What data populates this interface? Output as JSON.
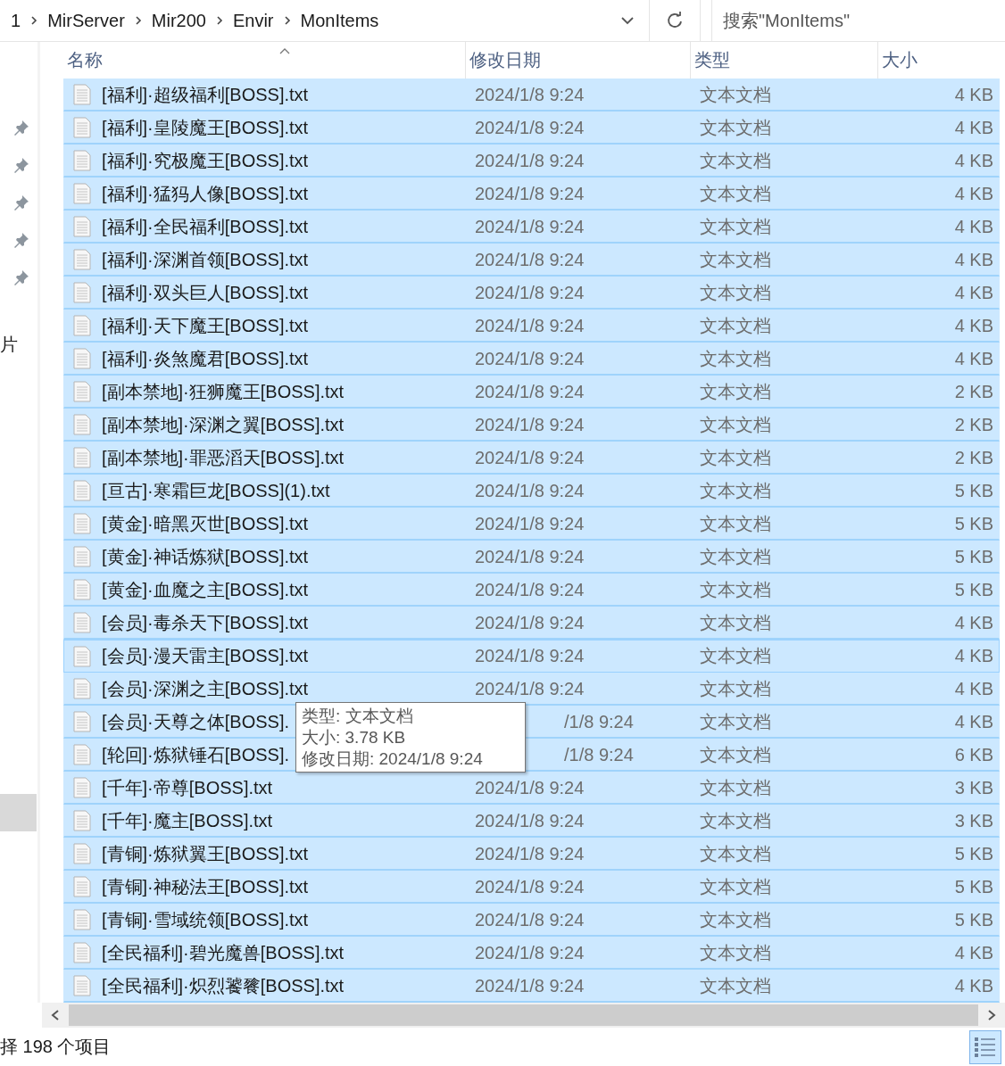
{
  "address_bar": {
    "path": [
      "1",
      "MirServer",
      "Mir200",
      "Envir",
      "MonItems"
    ]
  },
  "search": {
    "placeholder": "搜索\"MonItems\""
  },
  "sidebar": {
    "items": [
      {
        "kind": "text",
        "label": "片",
        "selected": false
      },
      {
        "kind": "blank",
        "selected": true
      }
    ]
  },
  "table": {
    "columns": [
      "名称",
      "修改日期",
      "类型",
      "大小"
    ],
    "rows": [
      {
        "name": "[福利]·超级福利[BOSS].txt",
        "date": "2024/1/8 9:24",
        "type": "文本文档",
        "size": "4 KB",
        "selected": true,
        "focused": false
      },
      {
        "name": "[福利]·皇陵魔王[BOSS].txt",
        "date": "2024/1/8 9:24",
        "type": "文本文档",
        "size": "4 KB",
        "selected": true,
        "focused": false
      },
      {
        "name": "[福利]·究极魔王[BOSS].txt",
        "date": "2024/1/8 9:24",
        "type": "文本文档",
        "size": "4 KB",
        "selected": true,
        "focused": false
      },
      {
        "name": "[福利]·猛犸人像[BOSS].txt",
        "date": "2024/1/8 9:24",
        "type": "文本文档",
        "size": "4 KB",
        "selected": true,
        "focused": false
      },
      {
        "name": "[福利]·全民福利[BOSS].txt",
        "date": "2024/1/8 9:24",
        "type": "文本文档",
        "size": "4 KB",
        "selected": true,
        "focused": false
      },
      {
        "name": "[福利]·深渊首领[BOSS].txt",
        "date": "2024/1/8 9:24",
        "type": "文本文档",
        "size": "4 KB",
        "selected": true,
        "focused": false
      },
      {
        "name": "[福利]·双头巨人[BOSS].txt",
        "date": "2024/1/8 9:24",
        "type": "文本文档",
        "size": "4 KB",
        "selected": true,
        "focused": false
      },
      {
        "name": "[福利]·天下魔王[BOSS].txt",
        "date": "2024/1/8 9:24",
        "type": "文本文档",
        "size": "4 KB",
        "selected": true,
        "focused": false
      },
      {
        "name": "[福利]·炎煞魔君[BOSS].txt",
        "date": "2024/1/8 9:24",
        "type": "文本文档",
        "size": "4 KB",
        "selected": true,
        "focused": false
      },
      {
        "name": "[副本禁地]·狂狮魔王[BOSS].txt",
        "date": "2024/1/8 9:24",
        "type": "文本文档",
        "size": "2 KB",
        "selected": true,
        "focused": false
      },
      {
        "name": "[副本禁地]·深渊之翼[BOSS].txt",
        "date": "2024/1/8 9:24",
        "type": "文本文档",
        "size": "2 KB",
        "selected": true,
        "focused": false
      },
      {
        "name": "[副本禁地]·罪恶滔天[BOSS].txt",
        "date": "2024/1/8 9:24",
        "type": "文本文档",
        "size": "2 KB",
        "selected": true,
        "focused": false
      },
      {
        "name": "[亘古]·寒霜巨龙[BOSS](1).txt",
        "date": "2024/1/8 9:24",
        "type": "文本文档",
        "size": "5 KB",
        "selected": true,
        "focused": false
      },
      {
        "name": "[黄金]·暗黑灭世[BOSS].txt",
        "date": "2024/1/8 9:24",
        "type": "文本文档",
        "size": "5 KB",
        "selected": true,
        "focused": false
      },
      {
        "name": "[黄金]·神话炼狱[BOSS].txt",
        "date": "2024/1/8 9:24",
        "type": "文本文档",
        "size": "5 KB",
        "selected": true,
        "focused": false
      },
      {
        "name": "[黄金]·血魔之主[BOSS].txt",
        "date": "2024/1/8 9:24",
        "type": "文本文档",
        "size": "5 KB",
        "selected": true,
        "focused": false
      },
      {
        "name": "[会员]·毒杀天下[BOSS].txt",
        "date": "2024/1/8 9:24",
        "type": "文本文档",
        "size": "4 KB",
        "selected": true,
        "focused": false
      },
      {
        "name": "[会员]·漫天雷主[BOSS].txt",
        "date": "2024/1/8 9:24",
        "type": "文本文档",
        "size": "4 KB",
        "selected": true,
        "focused": true
      },
      {
        "name": "[会员]·深渊之主[BOSS].txt",
        "date": "2024/1/8 9:24",
        "type": "文本文档",
        "size": "4 KB",
        "selected": true,
        "focused": false
      },
      {
        "name": "[会员]·天尊之体[BOSS].",
        "date": "/1/8 9:24",
        "type": "文本文档",
        "size": "4 KB",
        "selected": true,
        "focused": false
      },
      {
        "name": "[轮回]·炼狱锤石[BOSS].",
        "date": "/1/8 9:24",
        "type": "文本文档",
        "size": "6 KB",
        "selected": true,
        "focused": false
      },
      {
        "name": "[千年]·帝尊[BOSS].txt",
        "date": "2024/1/8 9:24",
        "type": "文本文档",
        "size": "3 KB",
        "selected": true,
        "focused": false
      },
      {
        "name": "[千年]·魔主[BOSS].txt",
        "date": "2024/1/8 9:24",
        "type": "文本文档",
        "size": "3 KB",
        "selected": true,
        "focused": false
      },
      {
        "name": "[青铜]·炼狱翼王[BOSS].txt",
        "date": "2024/1/8 9:24",
        "type": "文本文档",
        "size": "5 KB",
        "selected": true,
        "focused": false
      },
      {
        "name": "[青铜]·神秘法王[BOSS].txt",
        "date": "2024/1/8 9:24",
        "type": "文本文档",
        "size": "5 KB",
        "selected": true,
        "focused": false
      },
      {
        "name": "[青铜]·雪域统领[BOSS].txt",
        "date": "2024/1/8 9:24",
        "type": "文本文档",
        "size": "5 KB",
        "selected": true,
        "focused": false
      },
      {
        "name": "[全民福利]·碧光魔兽[BOSS].txt",
        "date": "2024/1/8 9:24",
        "type": "文本文档",
        "size": "4 KB",
        "selected": true,
        "focused": false
      },
      {
        "name": "[全民福利]·炽烈饕餮[BOSS].txt",
        "date": "2024/1/8 9:24",
        "type": "文本文档",
        "size": "4 KB",
        "selected": true,
        "focused": false
      }
    ]
  },
  "tooltip": {
    "lines": [
      "类型: 文本文档",
      "大小: 3.78 KB",
      "修改日期: 2024/1/8 9:24"
    ]
  },
  "status_bar": {
    "text": "择 198 个项目"
  }
}
